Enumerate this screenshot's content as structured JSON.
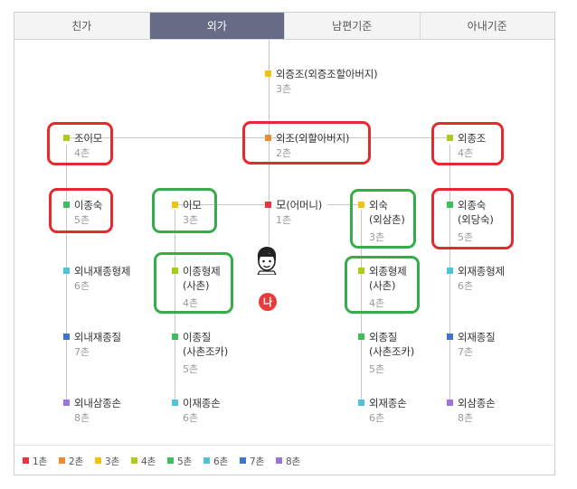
{
  "tabs": [
    {
      "label": "친가",
      "active": false
    },
    {
      "label": "외가",
      "active": true
    },
    {
      "label": "남편기준",
      "active": false
    },
    {
      "label": "아내기준",
      "active": false
    }
  ],
  "degree_colors": {
    "1": "#e8343a",
    "2": "#ef8a2e",
    "3": "#f2c212",
    "4": "#a9cc1d",
    "5": "#3cbf5c",
    "6": "#52c2d8",
    "7": "#3d74cc",
    "8": "#9a74d8"
  },
  "nodes": {
    "great_grandfather": {
      "label": "외증조(외증조할아버지)",
      "degree": "3촌"
    },
    "jo_imo": {
      "label": "조이모",
      "degree": "4촌"
    },
    "grandfather": {
      "label": "외조(외할아버지)",
      "degree": "2촌"
    },
    "great_uncle": {
      "label": "외종조",
      "degree": "4촌"
    },
    "i_jongsuk": {
      "label": "이종숙",
      "degree": "5촌"
    },
    "imo": {
      "label": "이모",
      "degree": "3촌"
    },
    "mother": {
      "label": "모",
      "label2": "(어머니)",
      "degree": "1촌"
    },
    "uncle": {
      "label": "외숙",
      "sub": "(외삼촌)",
      "degree": "3촌"
    },
    "oe_jongsuk": {
      "label": "외종숙",
      "sub": "(외당숙)",
      "degree": "5촌"
    },
    "left_6": {
      "label": "외내재종형제",
      "degree": "6촌"
    },
    "i_jonghyeongje": {
      "label": "이종형제",
      "sub": "(사촌)",
      "degree": "4촌"
    },
    "oe_jonghyeongje": {
      "label": "외종형제",
      "sub": "(사촌)",
      "degree": "4촌"
    },
    "right_6": {
      "label": "외재종형제",
      "degree": "6촌"
    },
    "left_7": {
      "label": "외내재종질",
      "degree": "7촌"
    },
    "i_jongjil": {
      "label": "이종질",
      "sub": "(사촌조카)",
      "degree": "5촌"
    },
    "oe_jongjil": {
      "label": "외종질",
      "sub": "(사촌조카)",
      "degree": "5촌"
    },
    "right_7": {
      "label": "외재종질",
      "degree": "7촌"
    },
    "left_8": {
      "label": "외내삼종손",
      "degree": "8촌"
    },
    "i_jaejongson": {
      "label": "이재종손",
      "degree": "6촌"
    },
    "oe_jaejongson": {
      "label": "외재종손",
      "degree": "6촌"
    },
    "right_8": {
      "label": "외삼종손",
      "degree": "8촌"
    }
  },
  "me_badge": "나",
  "legend": [
    "1촌",
    "2촌",
    "3촌",
    "4촌",
    "5촌",
    "6촌",
    "7촌",
    "8촌"
  ]
}
